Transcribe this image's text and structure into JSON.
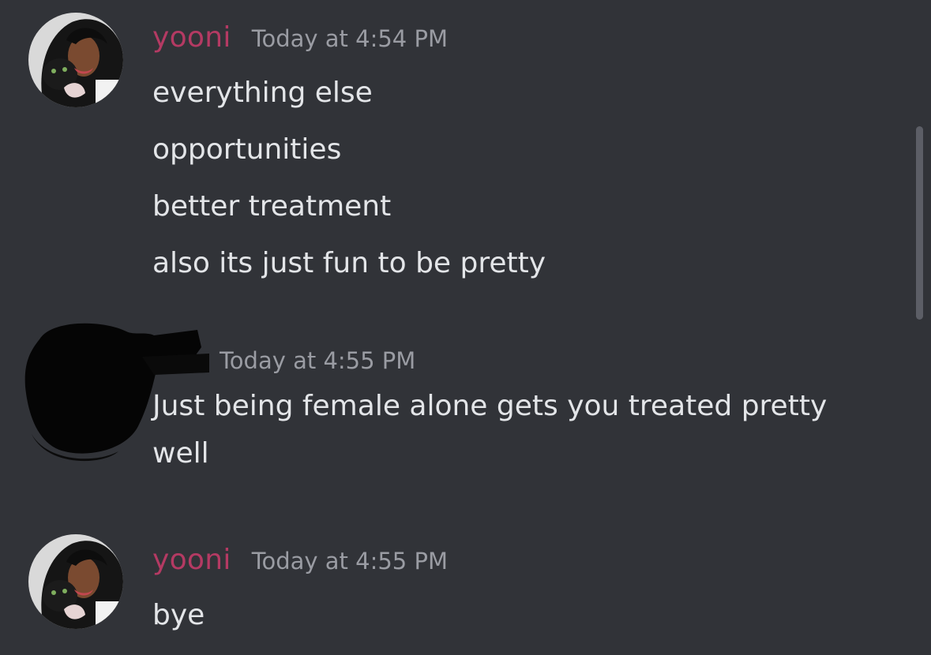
{
  "messages": [
    {
      "author": "yooni",
      "timestamp": "Today at 4:54 PM",
      "lines": [
        "everything else",
        "opportunities",
        "better treatment",
        "also its just fun to be pretty"
      ]
    },
    {
      "author": "",
      "timestamp": "Today at 4:55 PM",
      "lines": [
        "Just being female alone gets you treated pretty well"
      ]
    },
    {
      "author": "yooni",
      "timestamp": "Today at 4:55 PM",
      "lines": [
        "bye"
      ]
    }
  ],
  "colors": {
    "background": "#313338",
    "username": "#b43a63",
    "timestamp": "#9a9ca3",
    "message_text": "#e3e5e8"
  }
}
